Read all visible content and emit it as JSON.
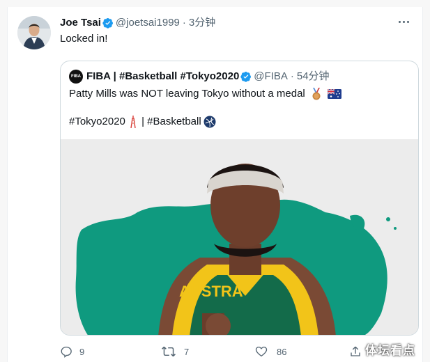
{
  "tweet": {
    "author_name": "Joe Tsai",
    "handle": "@joetsai1999",
    "separator": "·",
    "time": "3分钟",
    "text": "Locked in!"
  },
  "quote": {
    "author_name": "FIBA | #Basketball #Tokyo2020",
    "handle": "@FIBA",
    "separator": "·",
    "time": "54分钟",
    "text": "Patty Mills was NOT leaving Tokyo without a medal",
    "tags_part1": "#Tokyo2020",
    "tags_sep": " | ",
    "tags_part2": "#Basketball",
    "jersey_text": "AUSTRA"
  },
  "actions": {
    "reply_count": "9",
    "retweet_count": "7",
    "like_count": "86"
  },
  "watermark": "体坛看点",
  "colors": {
    "verified": "#1d9bf0",
    "text_muted": "#536471",
    "map_teal": "#0f9a7f",
    "jersey_yellow": "#f2c419",
    "jersey_green": "#136b4a"
  },
  "icons": {
    "more": "more-icon",
    "verified": "verified-badge-icon",
    "medal": "bronze-medal-emoji",
    "flag": "australia-flag-emoji",
    "tower": "tokyo-tower-emoji",
    "basketball": "basketball-logo-emoji",
    "reply": "reply-icon",
    "retweet": "retweet-icon",
    "like": "like-icon",
    "share": "share-icon"
  }
}
